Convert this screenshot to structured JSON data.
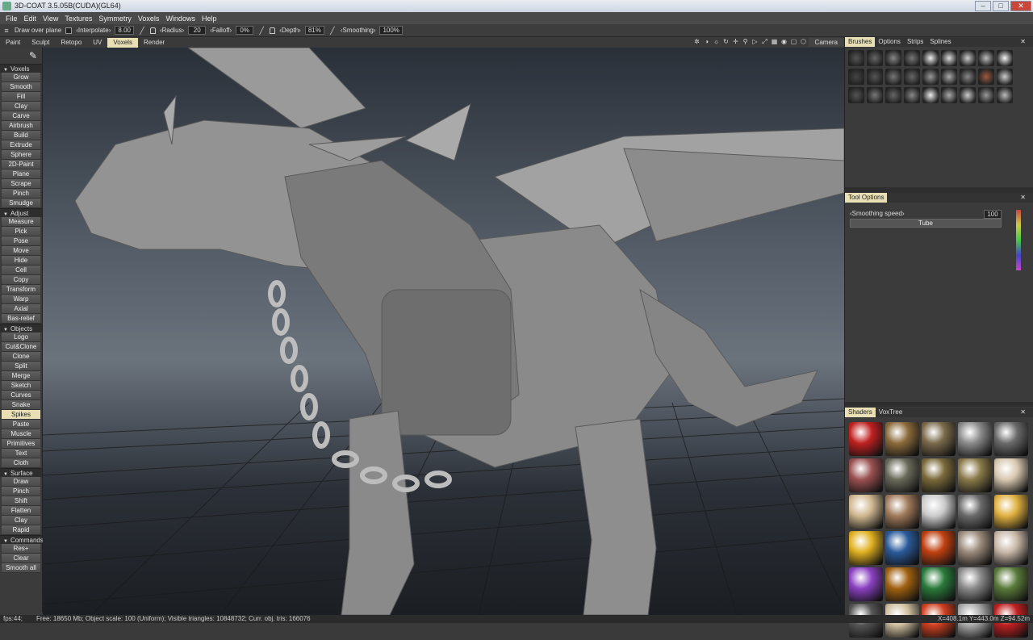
{
  "window": {
    "title": "3D-COAT 3.5.05B(CUDA)(GL64)"
  },
  "menu": [
    "File",
    "Edit",
    "View",
    "Textures",
    "Symmetry",
    "Voxels",
    "Windows",
    "Help"
  ],
  "toolbar": {
    "draw_over_plane": "Draw over plane",
    "interpolate_label": "‹Interpolate›",
    "interpolate_value": "8.00",
    "radius_label": "‹Radius›",
    "radius_value": "20",
    "falloff_label": "‹Falloff›",
    "falloff_value": "0%",
    "depth_label": "‹Depth›",
    "depth_value": "81%",
    "smoothing_label": "‹Smoothing›",
    "smoothing_value": "100%"
  },
  "rooms": [
    "Paint",
    "Sculpt",
    "Retopo",
    "UV",
    "Voxels",
    "Render"
  ],
  "active_room": "Voxels",
  "camera_label": "Camera",
  "left_sections": [
    {
      "title": "Voxels",
      "items": [
        "Grow",
        "Smooth",
        "Fill",
        "Clay",
        "Carve",
        "Airbrush",
        "Build",
        "Extrude",
        "Sphere",
        "2D-Paint",
        "Plane",
        "Scrape",
        "Pinch",
        "Smudge"
      ]
    },
    {
      "title": "Adjust",
      "items": [
        "Measure",
        "Pick",
        "Pose",
        "Move",
        "Hide",
        "Cell",
        "Copy",
        "Transform",
        "Warp",
        "Axial",
        "Bas-relief"
      ]
    },
    {
      "title": "Objects",
      "items": [
        "Logo",
        "Cut&Clone",
        "Clone",
        "Split",
        "Merge",
        "Sketch",
        "Curves",
        "Snake",
        "Spikes",
        "Paste",
        "Muscle",
        "Primitives",
        "Text",
        "Cloth"
      ]
    },
    {
      "title": "Surface",
      "items": [
        "Draw",
        "Pinch",
        "Shift",
        "Flatten",
        "Clay",
        "Rapid"
      ]
    },
    {
      "title": "Commands",
      "items": [
        "Res+",
        "Clear",
        "Smooth all"
      ]
    }
  ],
  "selected_tool": "Spikes",
  "right_panel": {
    "brush_tabs": [
      "Brushes",
      "Options",
      "Strips",
      "Splines"
    ],
    "tool_options_title": "Tool Options",
    "smoothing_speed_label": "‹Smoothing speed›",
    "smoothing_speed_value": "100",
    "tube_label": "Tube",
    "shader_tabs": [
      "Shaders",
      "VoxTree"
    ]
  },
  "status": {
    "fps": "fps:44;",
    "info": "Free: 18650 Mb; Object scale: 100 (Uniform); Visible triangles: 10848732; Curr. obj. tris: 166076",
    "coords": "X=408.1m Y=443.0m Z=94.52m"
  },
  "colors": {
    "accent_active": "#e8e0b4",
    "viewport_top": "#2a3038",
    "viewport_mid": "#6b737d"
  }
}
